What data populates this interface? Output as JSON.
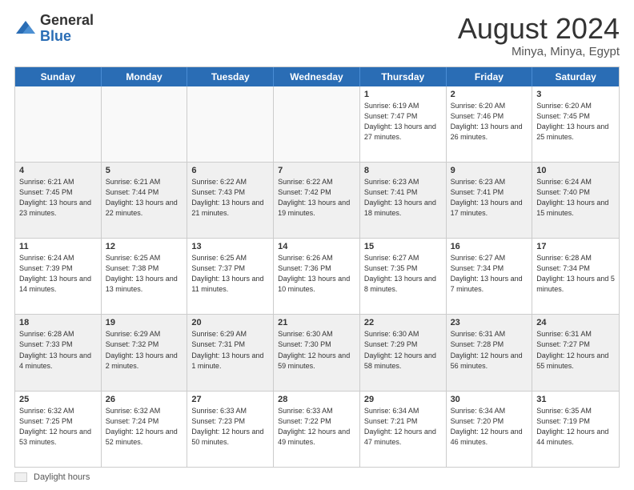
{
  "logo": {
    "general": "General",
    "blue": "Blue"
  },
  "header": {
    "month_year": "August 2024",
    "location": "Minya, Minya, Egypt"
  },
  "weekdays": [
    "Sunday",
    "Monday",
    "Tuesday",
    "Wednesday",
    "Thursday",
    "Friday",
    "Saturday"
  ],
  "rows": [
    [
      {
        "day": "",
        "info": ""
      },
      {
        "day": "",
        "info": ""
      },
      {
        "day": "",
        "info": ""
      },
      {
        "day": "",
        "info": ""
      },
      {
        "day": "1",
        "info": "Sunrise: 6:19 AM\nSunset: 7:47 PM\nDaylight: 13 hours and 27 minutes."
      },
      {
        "day": "2",
        "info": "Sunrise: 6:20 AM\nSunset: 7:46 PM\nDaylight: 13 hours and 26 minutes."
      },
      {
        "day": "3",
        "info": "Sunrise: 6:20 AM\nSunset: 7:45 PM\nDaylight: 13 hours and 25 minutes."
      }
    ],
    [
      {
        "day": "4",
        "info": "Sunrise: 6:21 AM\nSunset: 7:45 PM\nDaylight: 13 hours and 23 minutes."
      },
      {
        "day": "5",
        "info": "Sunrise: 6:21 AM\nSunset: 7:44 PM\nDaylight: 13 hours and 22 minutes."
      },
      {
        "day": "6",
        "info": "Sunrise: 6:22 AM\nSunset: 7:43 PM\nDaylight: 13 hours and 21 minutes."
      },
      {
        "day": "7",
        "info": "Sunrise: 6:22 AM\nSunset: 7:42 PM\nDaylight: 13 hours and 19 minutes."
      },
      {
        "day": "8",
        "info": "Sunrise: 6:23 AM\nSunset: 7:41 PM\nDaylight: 13 hours and 18 minutes."
      },
      {
        "day": "9",
        "info": "Sunrise: 6:23 AM\nSunset: 7:41 PM\nDaylight: 13 hours and 17 minutes."
      },
      {
        "day": "10",
        "info": "Sunrise: 6:24 AM\nSunset: 7:40 PM\nDaylight: 13 hours and 15 minutes."
      }
    ],
    [
      {
        "day": "11",
        "info": "Sunrise: 6:24 AM\nSunset: 7:39 PM\nDaylight: 13 hours and 14 minutes."
      },
      {
        "day": "12",
        "info": "Sunrise: 6:25 AM\nSunset: 7:38 PM\nDaylight: 13 hours and 13 minutes."
      },
      {
        "day": "13",
        "info": "Sunrise: 6:25 AM\nSunset: 7:37 PM\nDaylight: 13 hours and 11 minutes."
      },
      {
        "day": "14",
        "info": "Sunrise: 6:26 AM\nSunset: 7:36 PM\nDaylight: 13 hours and 10 minutes."
      },
      {
        "day": "15",
        "info": "Sunrise: 6:27 AM\nSunset: 7:35 PM\nDaylight: 13 hours and 8 minutes."
      },
      {
        "day": "16",
        "info": "Sunrise: 6:27 AM\nSunset: 7:34 PM\nDaylight: 13 hours and 7 minutes."
      },
      {
        "day": "17",
        "info": "Sunrise: 6:28 AM\nSunset: 7:34 PM\nDaylight: 13 hours and 5 minutes."
      }
    ],
    [
      {
        "day": "18",
        "info": "Sunrise: 6:28 AM\nSunset: 7:33 PM\nDaylight: 13 hours and 4 minutes."
      },
      {
        "day": "19",
        "info": "Sunrise: 6:29 AM\nSunset: 7:32 PM\nDaylight: 13 hours and 2 minutes."
      },
      {
        "day": "20",
        "info": "Sunrise: 6:29 AM\nSunset: 7:31 PM\nDaylight: 13 hours and 1 minute."
      },
      {
        "day": "21",
        "info": "Sunrise: 6:30 AM\nSunset: 7:30 PM\nDaylight: 12 hours and 59 minutes."
      },
      {
        "day": "22",
        "info": "Sunrise: 6:30 AM\nSunset: 7:29 PM\nDaylight: 12 hours and 58 minutes."
      },
      {
        "day": "23",
        "info": "Sunrise: 6:31 AM\nSunset: 7:28 PM\nDaylight: 12 hours and 56 minutes."
      },
      {
        "day": "24",
        "info": "Sunrise: 6:31 AM\nSunset: 7:27 PM\nDaylight: 12 hours and 55 minutes."
      }
    ],
    [
      {
        "day": "25",
        "info": "Sunrise: 6:32 AM\nSunset: 7:25 PM\nDaylight: 12 hours and 53 minutes."
      },
      {
        "day": "26",
        "info": "Sunrise: 6:32 AM\nSunset: 7:24 PM\nDaylight: 12 hours and 52 minutes."
      },
      {
        "day": "27",
        "info": "Sunrise: 6:33 AM\nSunset: 7:23 PM\nDaylight: 12 hours and 50 minutes."
      },
      {
        "day": "28",
        "info": "Sunrise: 6:33 AM\nSunset: 7:22 PM\nDaylight: 12 hours and 49 minutes."
      },
      {
        "day": "29",
        "info": "Sunrise: 6:34 AM\nSunset: 7:21 PM\nDaylight: 12 hours and 47 minutes."
      },
      {
        "day": "30",
        "info": "Sunrise: 6:34 AM\nSunset: 7:20 PM\nDaylight: 12 hours and 46 minutes."
      },
      {
        "day": "31",
        "info": "Sunrise: 6:35 AM\nSunset: 7:19 PM\nDaylight: 12 hours and 44 minutes."
      }
    ]
  ],
  "footer": {
    "daylight_label": "Daylight hours"
  }
}
